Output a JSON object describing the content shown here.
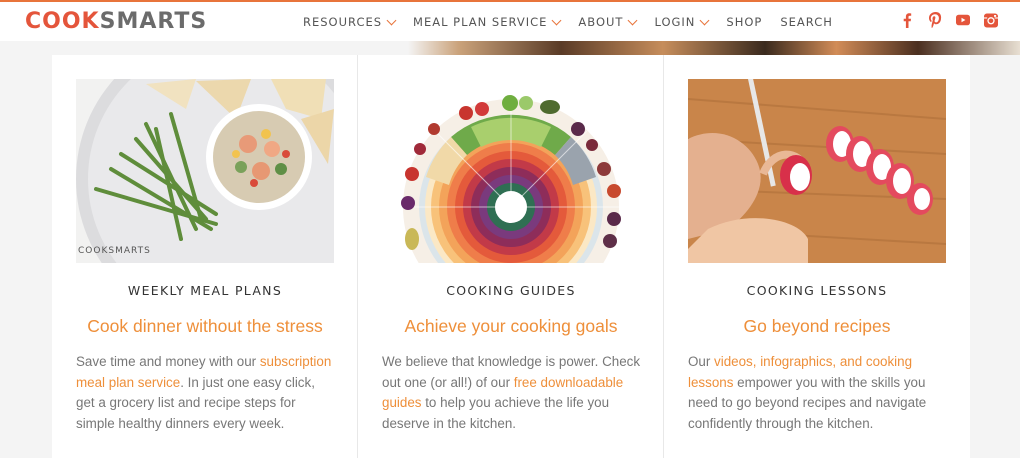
{
  "logo": {
    "part1": "COOK",
    "part2": "SMARTS"
  },
  "nav": [
    {
      "label": "RESOURCES",
      "dropdown": true
    },
    {
      "label": "MEAL PLAN SERVICE",
      "dropdown": true
    },
    {
      "label": "ABOUT",
      "dropdown": true
    },
    {
      "label": "LOGIN",
      "dropdown": true
    },
    {
      "label": "SHOP",
      "dropdown": false
    },
    {
      "label": "SEARCH",
      "dropdown": false
    }
  ],
  "social": [
    "facebook-icon",
    "pinterest-icon",
    "youtube-icon",
    "instagram-icon"
  ],
  "colors": {
    "accent": "#ee8f3a",
    "brand_red": "#e4553b"
  },
  "cards": [
    {
      "label": "WEEKLY MEAL PLANS",
      "title": "Cook dinner without the stress",
      "image_watermark": "COOKSMARTS",
      "body": [
        {
          "text": "Save time and money with our ",
          "link": false
        },
        {
          "text": "subscription meal plan service",
          "link": true
        },
        {
          "text": ". In just one easy click, get a grocery list and recipe steps for simple healthy dinners every week.",
          "link": false
        }
      ]
    },
    {
      "label": "COOKING GUIDES",
      "title": "Achieve your cooking goals",
      "body": [
        {
          "text": "We believe that knowledge is power. Check out one (or all!) of our ",
          "link": false
        },
        {
          "text": "free downloadable guides",
          "link": true
        },
        {
          "text": " to help you achieve the life you deserve in the kitchen.",
          "link": false
        }
      ]
    },
    {
      "label": "COOKING LESSONS",
      "title": "Go beyond recipes",
      "body": [
        {
          "text": "Our ",
          "link": false
        },
        {
          "text": "videos, infographics, and cooking lessons",
          "link": true
        },
        {
          "text": " empower you with the skills you need to go beyond recipes and navigate confidently through the kitchen.",
          "link": false
        }
      ]
    }
  ]
}
